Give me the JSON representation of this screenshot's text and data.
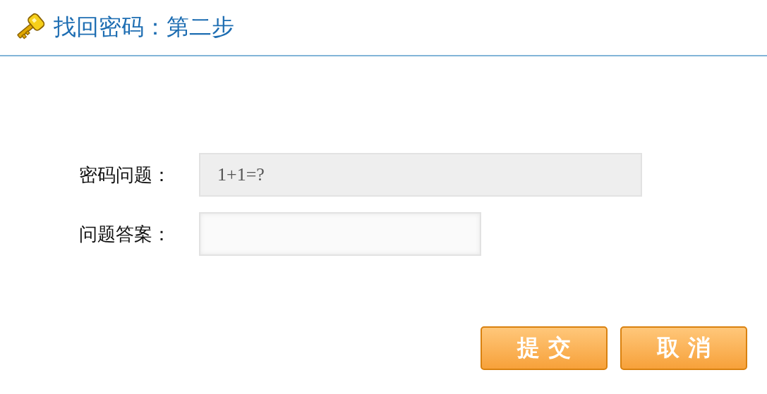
{
  "header": {
    "title": "找回密码：第二步"
  },
  "form": [
    {
      "kind": "readonly",
      "label": "密码问题：",
      "value": "1+1=?"
    },
    {
      "kind": "input",
      "label": "问题答案："
    }
  ],
  "buttons": [
    "提 交",
    "取 消"
  ]
}
